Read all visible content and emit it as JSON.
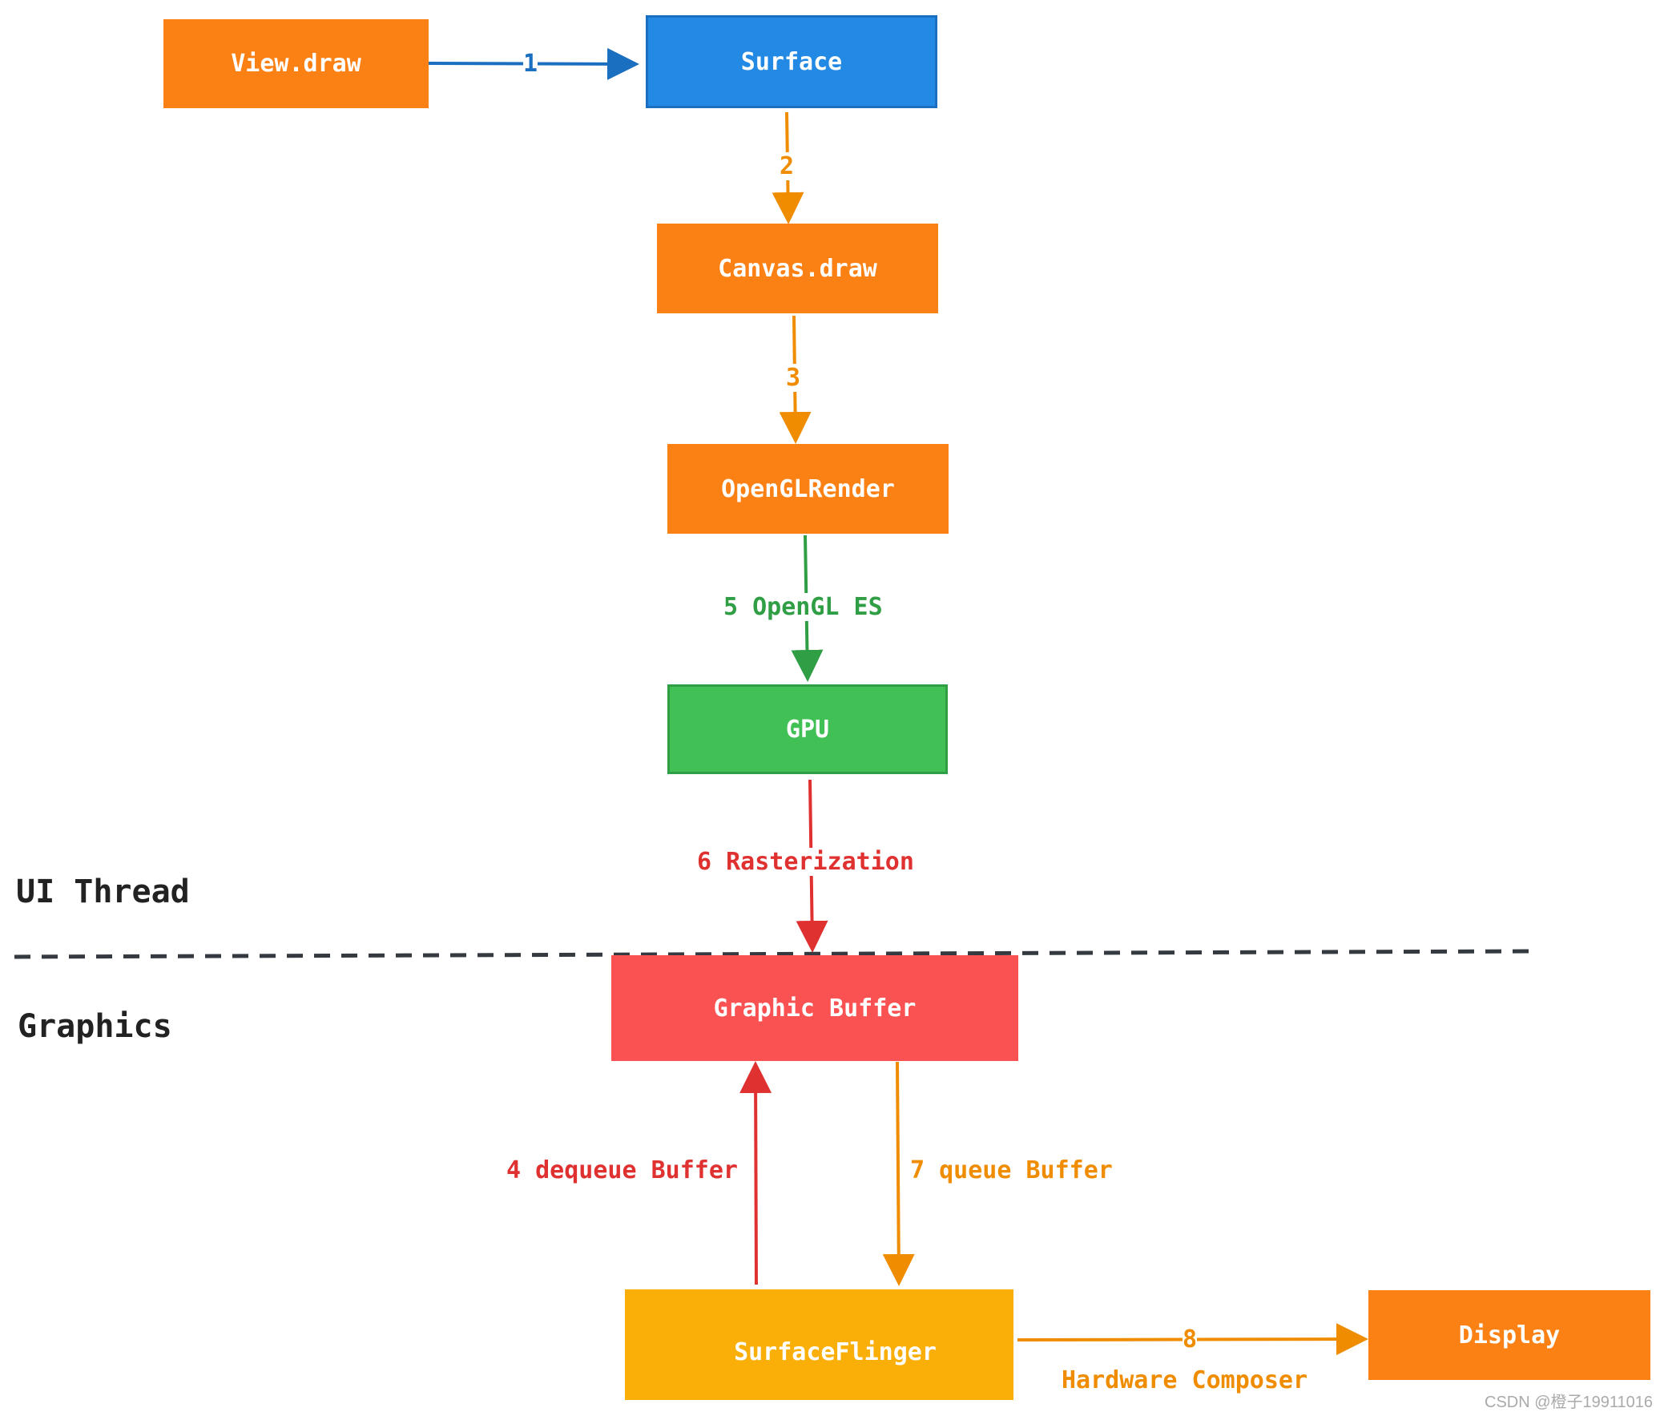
{
  "nodes": {
    "view_draw": "View.draw",
    "surface": "Surface",
    "canvas_draw": "Canvas.draw",
    "opengl_render": "OpenGLRender",
    "gpu": "GPU",
    "graphic_buffer": "Graphic Buffer",
    "surface_flinger": "SurfaceFlinger",
    "display": "Display"
  },
  "edges": {
    "e1": "1",
    "e2": "2",
    "e3": "3",
    "e5": "5 OpenGL ES",
    "e6": "6 Rasterization",
    "e4": "4 dequeue Buffer",
    "e7": "7 queue Buffer",
    "e8": "8",
    "e8_sub": "Hardware Composer"
  },
  "regions": {
    "ui_thread": "UI Thread",
    "graphics": "Graphics"
  },
  "watermark": "CSDN @橙子19911016",
  "colors": {
    "orange": "#fb8115",
    "blue": "#2289e4",
    "green": "#41c056",
    "red": "#fa5252",
    "yellow": "#f9af07",
    "edge_blue": "#1b6fc0",
    "edge_orange": "#f08c00",
    "edge_green": "#2f9e44",
    "edge_red": "#e03131"
  }
}
